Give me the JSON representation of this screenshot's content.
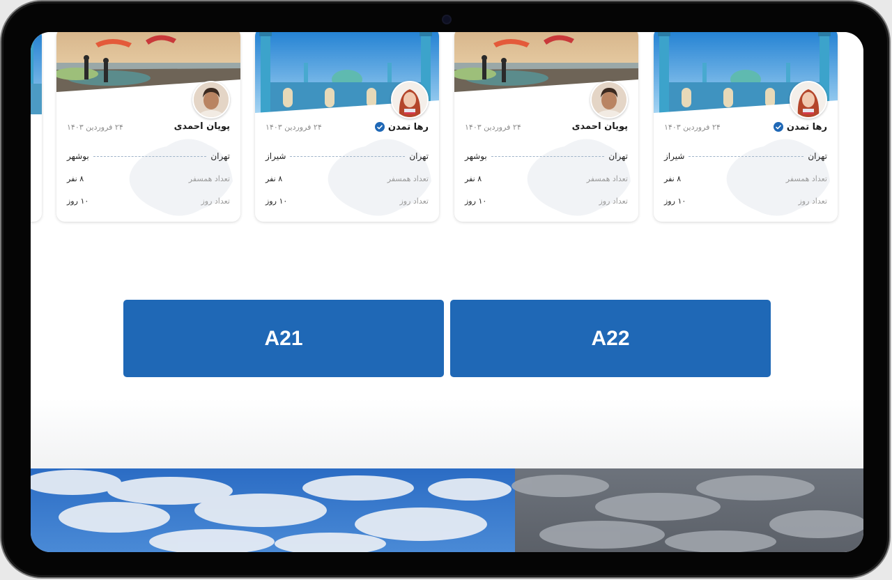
{
  "cards": [
    {
      "name": "پویان احمدی",
      "verified": false,
      "date": "۲۴ فروردین ۱۴۰۳",
      "origin": "تهران",
      "destination": "بوشهر",
      "travelers_label": "تعداد همسفر",
      "travelers_value": "۸ نفر",
      "days_label": "تعداد روز",
      "days_value": "۱۰ روز",
      "photo": "beach-paragliding"
    },
    {
      "name": "رها تمدن",
      "verified": true,
      "date": "۲۴ فروردین ۱۴۰۳",
      "origin": "تهران",
      "destination": "شیراز",
      "travelers_label": "تعداد همسفر",
      "travelers_value": "۸ نفر",
      "days_label": "تعداد روز",
      "days_value": "۱۰ روز",
      "photo": "mosque"
    },
    {
      "name": "پویان احمدی",
      "verified": false,
      "date": "۲۴ فروردین ۱۴۰۳",
      "origin": "تهران",
      "destination": "بوشهر",
      "travelers_label": "تعداد همسفر",
      "travelers_value": "۸ نفر",
      "days_label": "تعداد روز",
      "days_value": "۱۰ روز",
      "photo": "beach-paragliding"
    },
    {
      "name": "رها تمدن",
      "verified": true,
      "date": "۲۴ فروردین ۱۴۰۳",
      "origin": "تهران",
      "destination": "شیراز",
      "travelers_label": "تعداد همسفر",
      "travelers_value": "۸ نفر",
      "days_label": "تعداد روز",
      "days_value": "۱۰ روز",
      "photo": "mosque"
    }
  ],
  "buttons": {
    "a21_label": "A21",
    "a22_label": "A22"
  },
  "colors": {
    "accent": "#1f68b6",
    "verified": "#1f68b6"
  },
  "icons": {
    "verified": "verified-badge-icon"
  }
}
